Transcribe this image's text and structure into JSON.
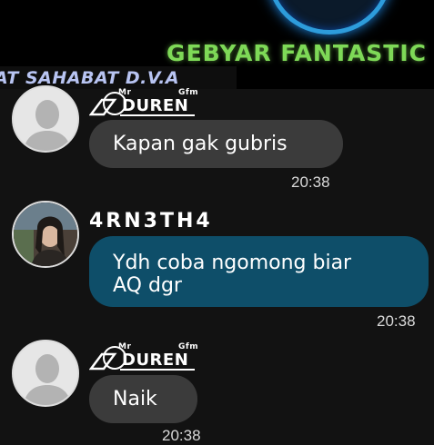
{
  "banner": {
    "title": "GEBYAR FANTASTIC",
    "subtitle": "AT SAHABAT D.V.A",
    "colors": {
      "title": "#7ed957",
      "subtitle": "#b8c4f2",
      "ring": "#2d9cdb"
    }
  },
  "messages": [
    {
      "sender_logo": {
        "small": "Mr",
        "main": "DUREN",
        "tag": "Gfm"
      },
      "text": "Kapan gak gubris",
      "time": "20:38",
      "bubble_color": "#3b3b3b"
    },
    {
      "sender": "4RN3TH4",
      "text_line1": "Ydh coba ngomong biar",
      "text_line2": "AQ dgr",
      "time": "20:38",
      "bubble_color": "#0e4e69"
    },
    {
      "sender_logo": {
        "small": "Mr",
        "main": "DUREN",
        "tag": "Gfm"
      },
      "text": "Naik",
      "time": "20:38",
      "bubble_color": "#3b3b3b"
    }
  ]
}
